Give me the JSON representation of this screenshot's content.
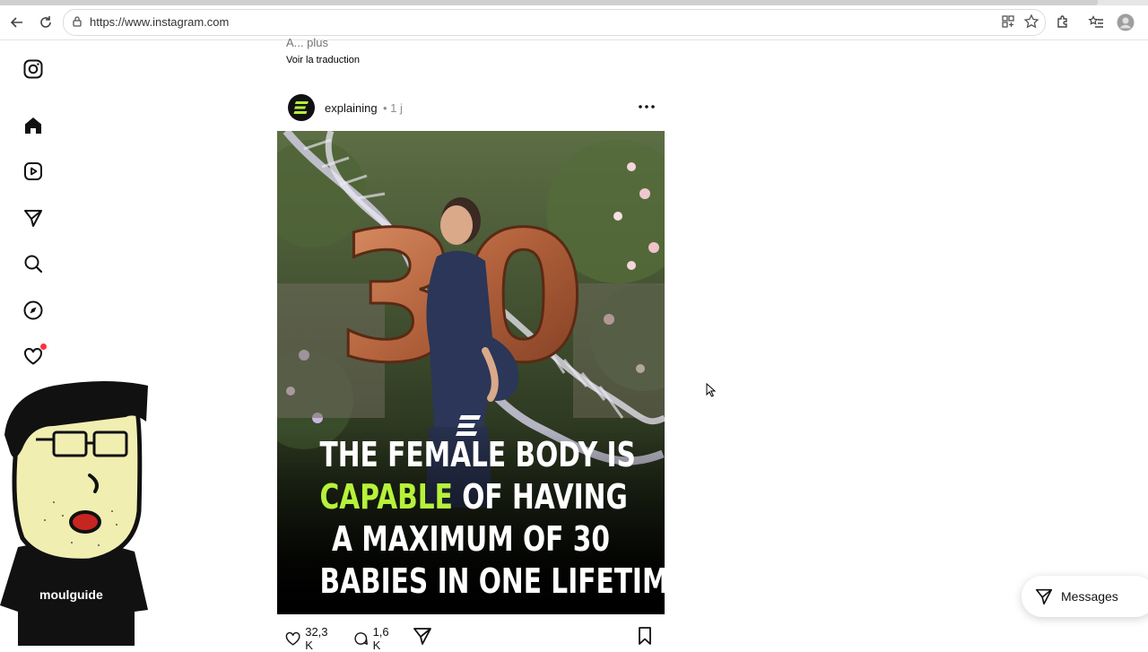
{
  "browser": {
    "url": "https://www.instagram.com",
    "icons": [
      "back-icon",
      "reload-icon",
      "site-info-icon",
      "app-install-icon",
      "favorite-star-icon",
      "extensions-icon",
      "favorites-icon",
      "profile-icon"
    ]
  },
  "sidebar": {
    "items": [
      "instagram-logo-icon",
      "home-icon",
      "reels-icon",
      "messages-icon",
      "search-icon",
      "explore-icon",
      "notifications-icon",
      "create-icon"
    ]
  },
  "post": {
    "caption_more": "A... plus",
    "translate_label": "Voir la traduction",
    "username": "explaining",
    "time": "• 1 j",
    "image": {
      "big_number": "30",
      "caption_lines": [
        {
          "text": "THE FEMALE BODY IS"
        },
        {
          "accent": "CAPABLE",
          "text": " OF HAVING"
        },
        {
          "text": "A MAXIMUM OF 30"
        },
        {
          "text": "BABIES IN ONE LIFETIME"
        }
      ],
      "accent_color": "#b6f23a"
    },
    "likes": "32,3 K",
    "comments": "1,6 K"
  },
  "messages_button": {
    "label": "Messages"
  },
  "overlay": {
    "mascot_label": "moulguide"
  }
}
